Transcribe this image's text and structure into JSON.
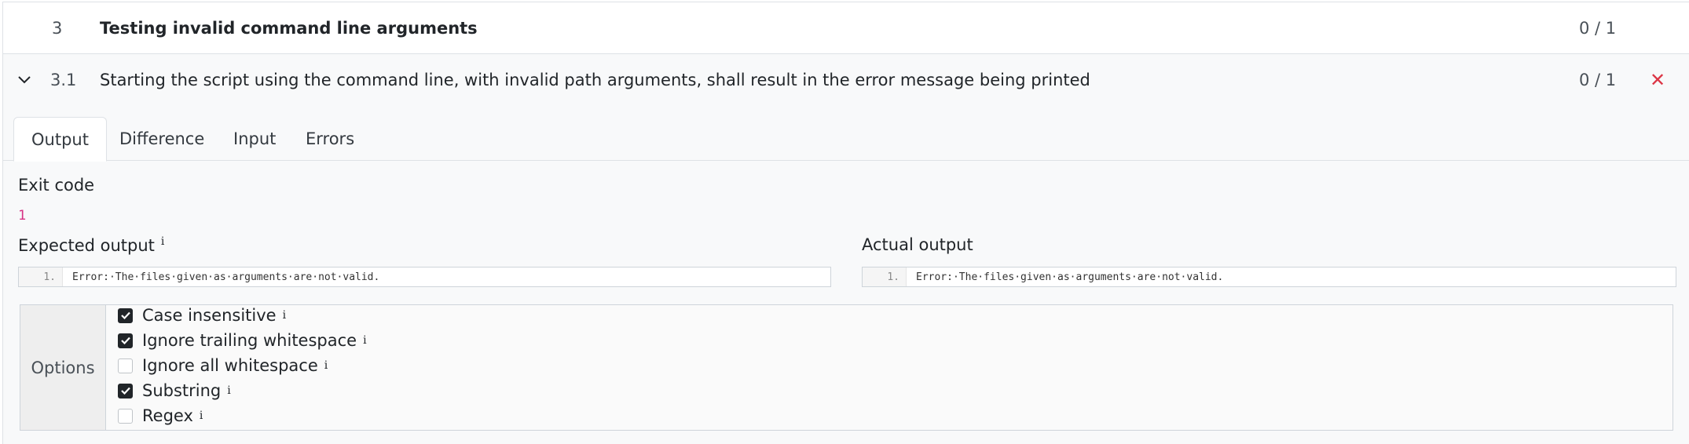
{
  "group": {
    "number": "3",
    "title": "Testing invalid command line arguments",
    "score": "0 / 1"
  },
  "test": {
    "number": "3.1",
    "title": "Starting the script using the command line, with invalid path arguments, shall result in the error message being printed",
    "score": "0 / 1",
    "status_icon": "cross-icon"
  },
  "tabs": [
    {
      "label": "Output",
      "active": true
    },
    {
      "label": "Difference",
      "active": false
    },
    {
      "label": "Input",
      "active": false
    },
    {
      "label": "Errors",
      "active": false
    }
  ],
  "output": {
    "exit_code_label": "Exit code",
    "exit_code_value": "1",
    "expected_label": "Expected output",
    "expected_info": "i",
    "expected_lines": [
      {
        "n": "1.",
        "text": "Error:·The·files·given·as·arguments·are·not·valid."
      }
    ],
    "actual_label": "Actual output",
    "actual_lines": [
      {
        "n": "1.",
        "text": "Error:·The·files·given·as·arguments·are·not·valid."
      }
    ]
  },
  "options": {
    "label": "Options",
    "items": [
      {
        "label": "Case insensitive",
        "checked": true,
        "info": "i"
      },
      {
        "label": "Ignore trailing whitespace",
        "checked": true,
        "info": "i"
      },
      {
        "label": "Ignore all whitespace",
        "checked": false,
        "info": "i"
      },
      {
        "label": "Substring",
        "checked": true,
        "info": "i"
      },
      {
        "label": "Regex",
        "checked": false,
        "info": "i"
      }
    ]
  },
  "colors": {
    "fail": "#dc3545",
    "exit_code": "#d63384"
  }
}
